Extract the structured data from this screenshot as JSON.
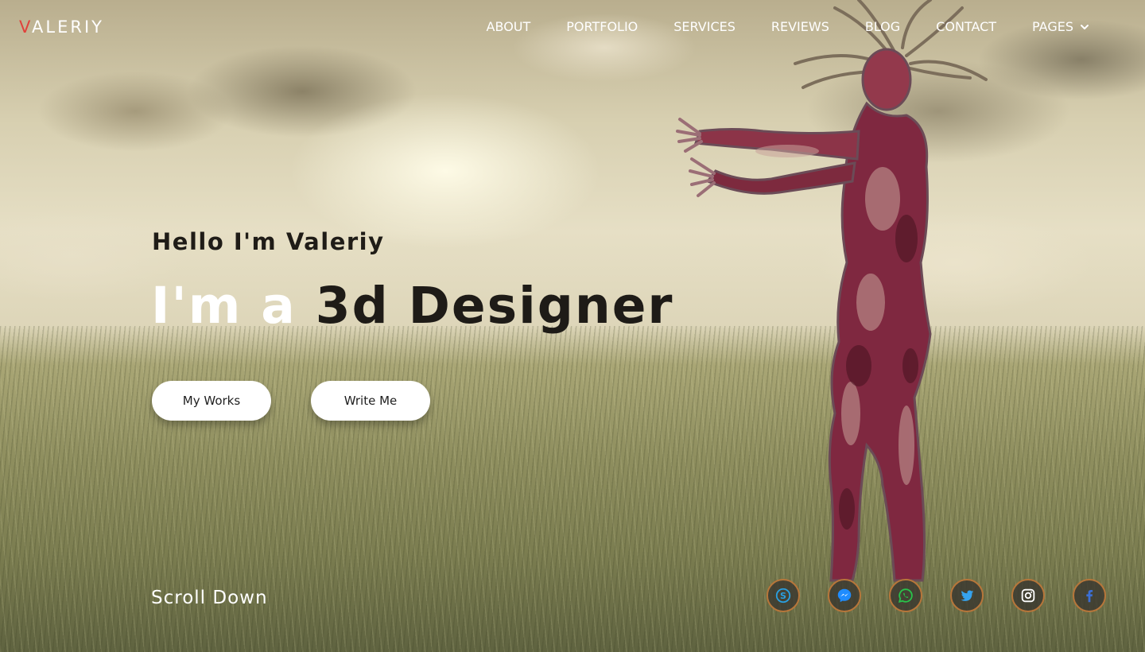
{
  "brand": {
    "logo_first": "V",
    "logo_rest": "ALERIY"
  },
  "nav": {
    "items": [
      {
        "label": "ABOUT"
      },
      {
        "label": "PORTFOLIO"
      },
      {
        "label": "SERVICES"
      },
      {
        "label": "REVIEWS"
      },
      {
        "label": "BLOG"
      },
      {
        "label": "CONTACT"
      },
      {
        "label": "PAGES"
      }
    ],
    "dropdown_icon": "chevron-down-icon"
  },
  "hero": {
    "hello": "Hello I'm Valeriy",
    "title_prefix": "I'm a ",
    "title_highlight": "3d Designer",
    "buttons": {
      "works": "My Works",
      "write": "Write Me"
    }
  },
  "scroll_label": "Scroll Down",
  "social": [
    {
      "icon": "skype-icon",
      "color": "#2a9fe0"
    },
    {
      "icon": "messenger-icon",
      "color": "#1f8cff"
    },
    {
      "icon": "whatsapp-icon",
      "color": "#29c24a"
    },
    {
      "icon": "twitter-icon",
      "color": "#36a3ee"
    },
    {
      "icon": "instagram-icon",
      "color": "#ffffff"
    },
    {
      "icon": "facebook-icon",
      "color": "#3b6fd6"
    }
  ],
  "colors": {
    "accent": "#e0413b",
    "social_border": "#b7763a"
  }
}
